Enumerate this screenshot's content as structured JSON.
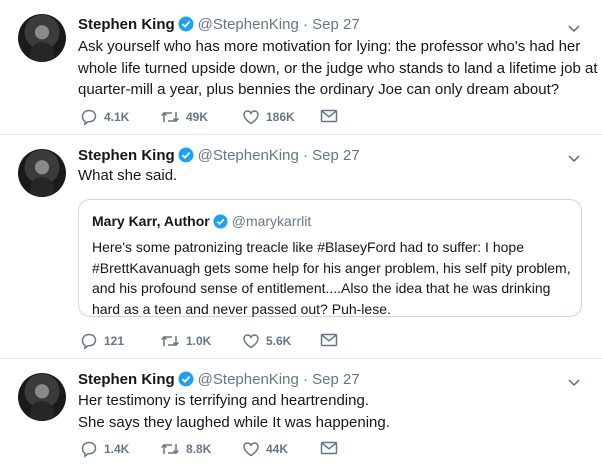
{
  "tweets": [
    {
      "name": "Stephen King",
      "meta": "@StephenKing · Sep 27",
      "lines": [
        "Ask yourself who has more motivation for lying: the professor who's had her",
        "whole life turned upside down, or the judge who stands to land a lifetime job at a",
        "quarter-mill a year, plus bennies the ordinary Joe can only dream about?"
      ],
      "replies": "4.1K",
      "retweets": "49K",
      "likes": "186K"
    },
    {
      "name": "Stephen King",
      "meta": "@StephenKing · Sep 27",
      "lines": [
        "What she said."
      ],
      "quote": {
        "name": "Mary Karr, Author",
        "meta": "@marykarrlit",
        "lines": [
          "Here's some patronizing treacle like #BlaseyFord had to suffer: I hope",
          "#BrettKavanuagh gets some help for his anger problem, his self pity problem,",
          "and his profound sense of entitlement....Also the idea that he was drinking",
          "hard as a teen and never passed out? Puh-lese."
        ]
      },
      "replies": "121",
      "retweets": "1.0K",
      "likes": "5.6K"
    },
    {
      "name": "Stephen King",
      "meta": "@StephenKing · Sep 27",
      "lines": [
        "Her testimony is terrifying and heartrending.",
        "She says they laughed while It was happening."
      ],
      "replies": "1.4K",
      "retweets": "8.8K",
      "likes": "44K"
    }
  ],
  "colors": {
    "verified": "#1da1f2",
    "muted": "#657786",
    "divider": "#e6ecf0"
  },
  "icons": [
    "reply-icon",
    "retweet-icon",
    "like-icon",
    "message-icon",
    "chevron-down-icon",
    "verified-badge-icon"
  ]
}
